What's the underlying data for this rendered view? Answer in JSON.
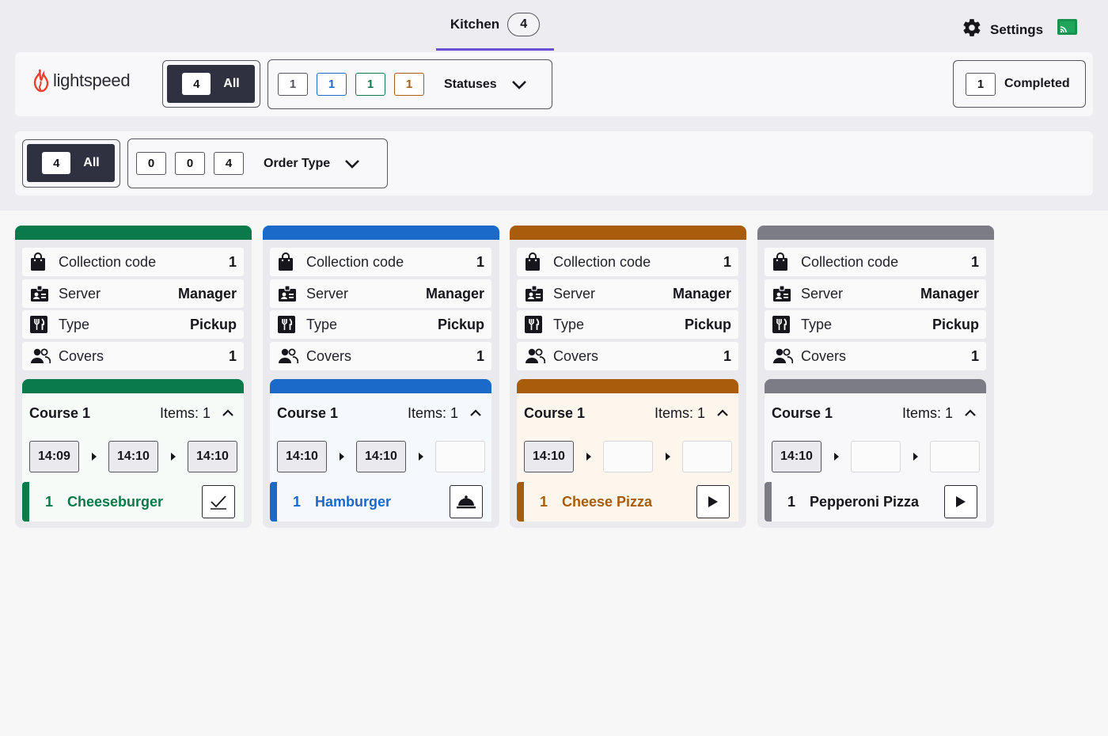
{
  "header": {
    "tab_label": "Kitchen",
    "tab_count": "4",
    "settings_label": "Settings"
  },
  "brand": {
    "name": "lightspeed"
  },
  "status_filter": {
    "all_count": "4",
    "all_label": "All",
    "counts": [
      "1",
      "1",
      "1",
      "1"
    ],
    "count_colors": [
      "#55555d",
      "#1b69c8",
      "#0e7a4d",
      "#a85c0c"
    ],
    "dropdown_label": "Statuses"
  },
  "completed": {
    "count": "1",
    "label": "Completed"
  },
  "order_type_filter": {
    "all_count": "4",
    "all_label": "All",
    "counts": [
      "0",
      "0",
      "4"
    ],
    "dropdown_label": "Order Type"
  },
  "orders": [
    {
      "color": "#0a7a4a",
      "tint": "#f6fbf8",
      "info": {
        "collection_label": "Collection code",
        "collection_value": "1",
        "server_label": "Server",
        "server_value": "Manager",
        "type_label": "Type",
        "type_value": "Pickup",
        "covers_label": "Covers",
        "covers_value": "1"
      },
      "course_title": "Course 1",
      "items_label": "Items: 1",
      "times": [
        "14:09",
        "14:10",
        "14:10"
      ],
      "item_qty": "1",
      "item_name": "Cheeseburger",
      "action_icon": "checkmark-icon"
    },
    {
      "color": "#1b69c8",
      "tint": "#f5f8fc",
      "info": {
        "collection_label": "Collection code",
        "collection_value": "1",
        "server_label": "Server",
        "server_value": "Manager",
        "type_label": "Type",
        "type_value": "Pickup",
        "covers_label": "Covers",
        "covers_value": "1"
      },
      "course_title": "Course 1",
      "items_label": "Items: 1",
      "times": [
        "14:10",
        "14:10",
        ""
      ],
      "item_qty": "1",
      "item_name": "Hamburger",
      "action_icon": "cloche-icon"
    },
    {
      "color": "#a85c0c",
      "tint": "#fdf6ec",
      "info": {
        "collection_label": "Collection code",
        "collection_value": "1",
        "server_label": "Server",
        "server_value": "Manager",
        "type_label": "Type",
        "type_value": "Pickup",
        "covers_label": "Covers",
        "covers_value": "1"
      },
      "course_title": "Course 1",
      "items_label": "Items: 1",
      "times": [
        "14:10",
        "",
        ""
      ],
      "item_qty": "1",
      "item_name": "Cheese Pizza",
      "action_icon": "play-icon"
    },
    {
      "color": "#7c7c86",
      "tint": "#f8f8fa",
      "info": {
        "collection_label": "Collection code",
        "collection_value": "1",
        "server_label": "Server",
        "server_value": "Manager",
        "type_label": "Type",
        "type_value": "Pickup",
        "covers_label": "Covers",
        "covers_value": "1"
      },
      "course_title": "Course 1",
      "items_label": "Items: 1",
      "times": [
        "14:10",
        "",
        ""
      ],
      "item_qty": "1",
      "item_name": "Pepperoni Pizza",
      "action_icon": "play-icon"
    }
  ]
}
